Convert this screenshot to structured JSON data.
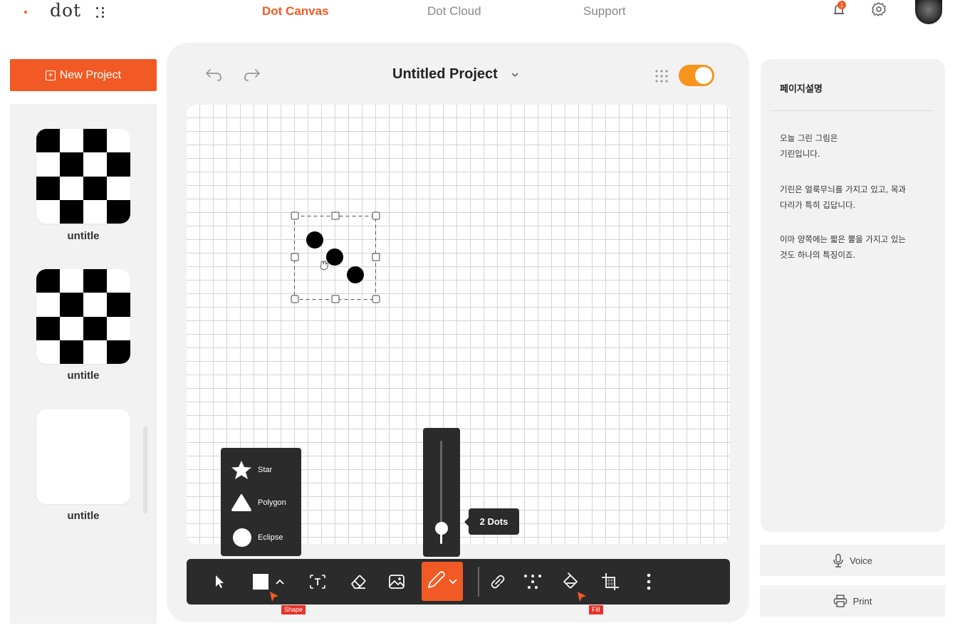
{
  "header": {
    "logo_text": "dot",
    "nav": [
      "Dot Canvas",
      "Dot Cloud",
      "Support"
    ],
    "active_nav": "Dot Canvas",
    "notification_count": "1",
    "icons": [
      "bell-icon",
      "gear-icon",
      "avatar"
    ]
  },
  "sidebar": {
    "new_project_label": "New Project",
    "projects": [
      {
        "label": "untitle",
        "pattern": "checker"
      },
      {
        "label": "untitle",
        "pattern": "checker"
      },
      {
        "label": "untitle",
        "pattern": "blank"
      }
    ]
  },
  "editor": {
    "project_title": "Untitled Project",
    "grid_toggle_on": true,
    "shape_menu": [
      {
        "label": "Star",
        "icon": "star-icon"
      },
      {
        "label": "Polygon",
        "icon": "triangle-icon"
      },
      {
        "label": "Eclipse",
        "icon": "circle-icon"
      }
    ],
    "dot_size_label": "2 Dots",
    "dot_size_level": 0.15,
    "selection_dot_count": 3,
    "toolbar": {
      "tools": [
        "select-icon",
        "shape-icon",
        "text-icon",
        "eraser-icon",
        "image-icon",
        "pen-icon",
        "link-icon",
        "dots-icon",
        "fill-icon",
        "crop-icon",
        "more-icon"
      ],
      "active_tool": "pen-icon",
      "shape_tag": "Shape",
      "fill_tag": "Fill"
    }
  },
  "description": {
    "title": "페이지설명",
    "paragraphs": [
      "오늘 그린 그림은\n기린입니다.",
      "기린은 얼룩무늬를 가지고 있고, 목과\n다리가 특히 깁답니다.",
      "이마 양쪽에는 짧은 뿔을 가지고 있는\n것도 하나의 특징이죠."
    ],
    "voice_label": "Voice",
    "print_label": "Print"
  },
  "colors": {
    "accent": "#f15a24",
    "toggle": "#f7941d",
    "toolbar_bg": "#2b2b2b",
    "tag_red": "#e8322a"
  }
}
